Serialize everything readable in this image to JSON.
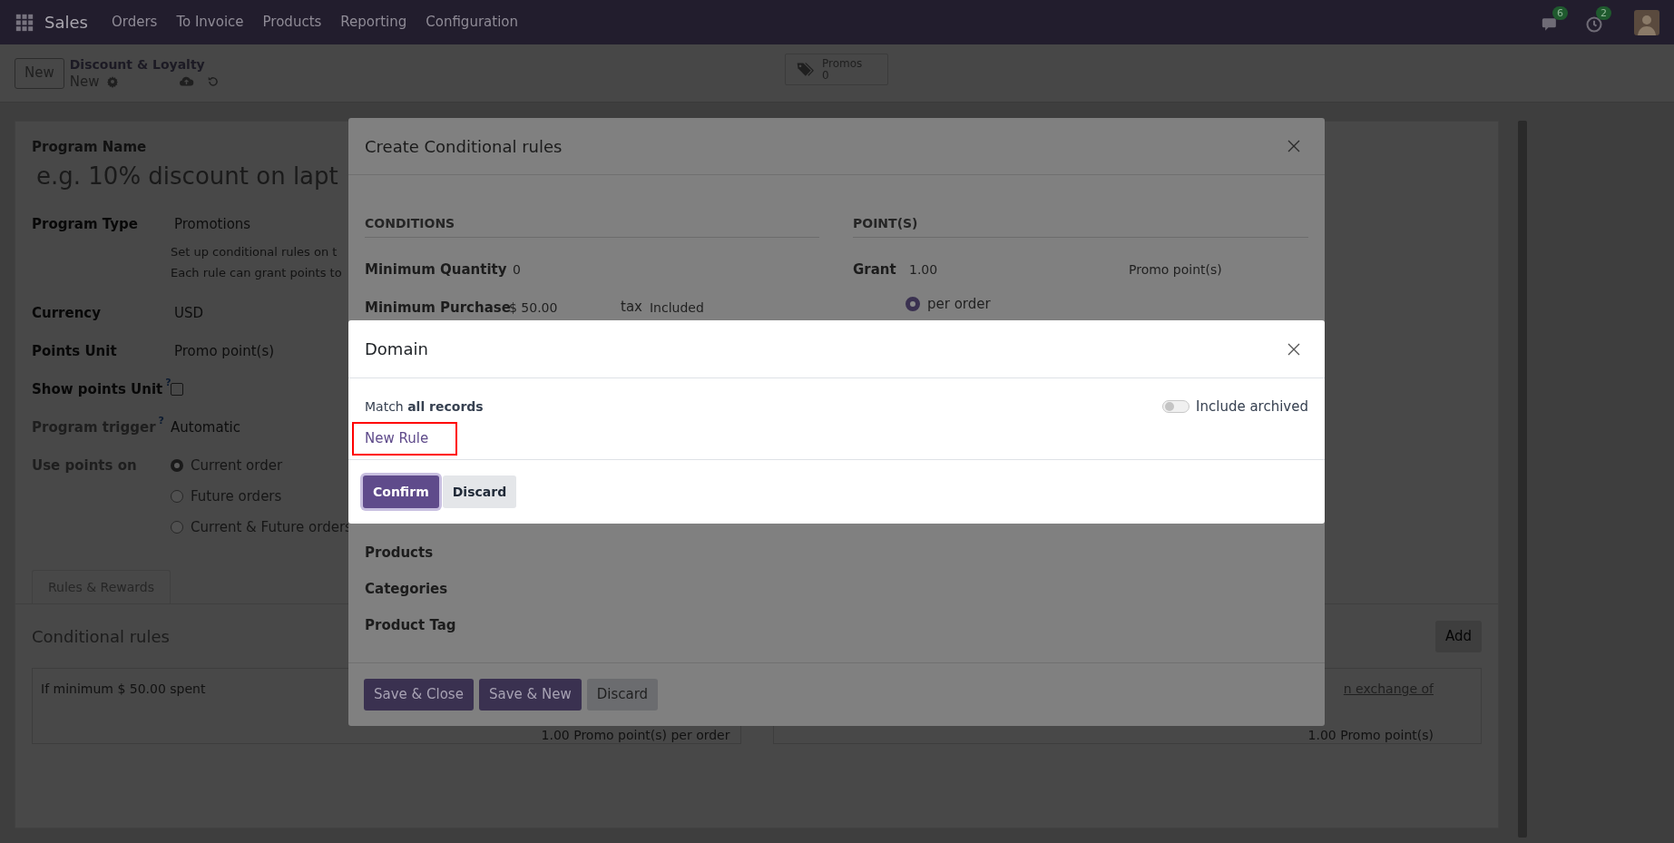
{
  "navbar": {
    "app_name": "Sales",
    "menu": [
      "Orders",
      "To Invoice",
      "Products",
      "Reporting",
      "Configuration"
    ],
    "messages_badge": "6",
    "activities_badge": "2"
  },
  "control_panel": {
    "new_button": "New",
    "breadcrumb": "Discount & Loyalty",
    "record": "New",
    "stat_button": {
      "label": "Promos",
      "value": "0"
    }
  },
  "form": {
    "name_label": "Program Name",
    "name_placeholder": "e.g. 10% discount on lapt",
    "fields": [
      {
        "kind": "value",
        "label": "Program Type",
        "value": "Promotions",
        "disabled": false,
        "description": [
          "Set up conditional rules on t",
          "Each rule can grant points to"
        ]
      },
      {
        "kind": "value",
        "label": "Currency",
        "value": "USD",
        "disabled": false
      },
      {
        "kind": "value",
        "label": "Points Unit",
        "value": "Promo point(s)",
        "disabled": false
      },
      {
        "kind": "checkbox",
        "label": "Show points Unit",
        "help_mark": "?",
        "checked": false,
        "disabled": false
      },
      {
        "kind": "value",
        "label": "Program trigger",
        "help_mark": "?",
        "value": "Automatic",
        "disabled": true
      },
      {
        "kind": "radio",
        "label": "Use points on",
        "disabled": true,
        "options": [
          {
            "label": "Current order",
            "selected": true
          },
          {
            "label": "Future orders",
            "selected": false
          },
          {
            "label": "Current & Future orders",
            "selected": false
          }
        ]
      }
    ]
  },
  "tabs": [
    {
      "label": "Rules & Rewards",
      "selected": true
    }
  ],
  "rules": {
    "title": "Conditional rules",
    "add_button": "Add",
    "rule_card": {
      "text": "If minimum $ 50.00 spent",
      "summary": "1.00 Promo point(s) per order"
    },
    "reward_card": {
      "link": "n exchange of",
      "summary": "1.00 Promo point(s)"
    }
  },
  "rule_dialog": {
    "title": "Create Conditional rules",
    "conditions_heading": "CONDITIONS",
    "points_heading": "POINT(S)",
    "min_quantity": {
      "label": "Minimum Quantity",
      "value": "0"
    },
    "min_purchase": {
      "label": "Minimum Purchase",
      "value": "$ 50.00",
      "tax_label": "tax",
      "tax_value": "Included"
    },
    "grant": {
      "label": "Grant",
      "value": "1.00",
      "unit": "Promo point(s)"
    },
    "per_options": [
      {
        "label": "per order",
        "selected": true
      }
    ],
    "product_fields": [
      "Products",
      "Categories",
      "Product Tag"
    ],
    "buttons": [
      {
        "label": "Save & Close",
        "kind": "primary"
      },
      {
        "label": "Save & New",
        "kind": "primary"
      },
      {
        "label": "Discard",
        "kind": "secondary"
      }
    ]
  },
  "domain_dialog": {
    "title": "Domain",
    "match": "Match **all records**",
    "include_archived": {
      "label": "Include archived",
      "on": false
    },
    "new_rule": "New Rule",
    "highlighted": true,
    "buttons": [
      {
        "label": "Confirm",
        "kind": "primary"
      },
      {
        "label": "Discard",
        "kind": "secondary"
      }
    ]
  }
}
